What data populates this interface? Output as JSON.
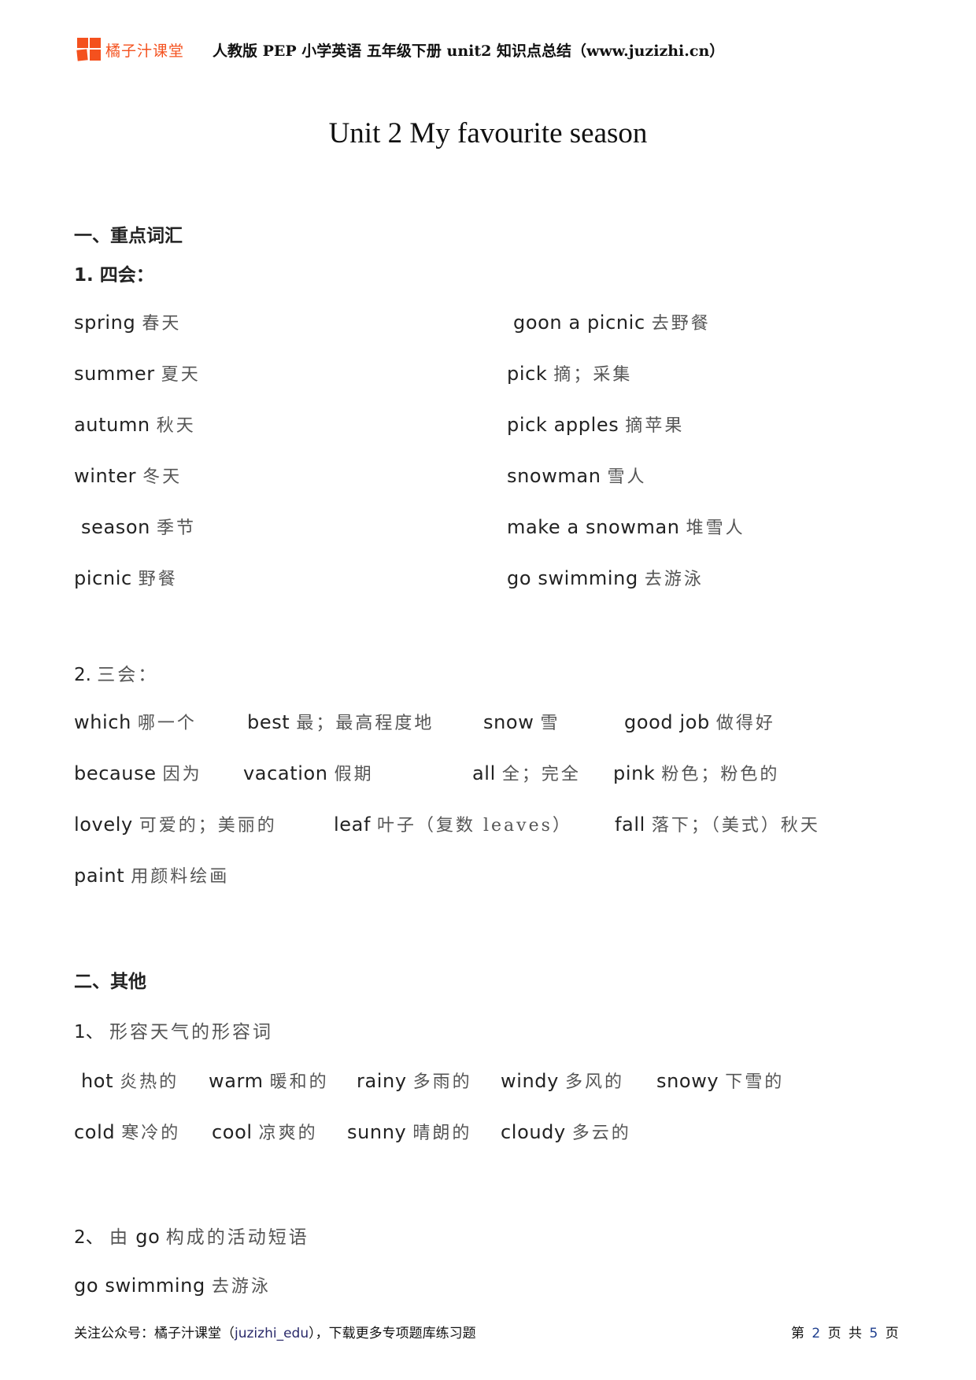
{
  "header": {
    "brand": "橘子汁课堂",
    "brand_color": "#f4511e",
    "text": "人教版 PEP 小学英语 五年级下册   unit2 知识点总结（www.juzizhi.cn）"
  },
  "title": "Unit 2 My favourite season",
  "section1": {
    "heading": "一、重点词汇",
    "four_skills": {
      "label": "1. 四会：",
      "left": [
        {
          "en": "spring",
          "zh": "春天"
        },
        {
          "en": "summer",
          "zh": "夏天"
        },
        {
          "en": "autumn",
          "zh": "秋天"
        },
        {
          "en": "winter",
          "zh": "冬天"
        },
        {
          "en": "season",
          "zh": "季节"
        },
        {
          "en": "picnic",
          "zh": "野餐"
        }
      ],
      "right": [
        {
          "en": "goon a picnic",
          "zh": "去野餐"
        },
        {
          "en": "pick",
          "zh": "摘；采集"
        },
        {
          "en": "pick apples",
          "zh": "摘苹果"
        },
        {
          "en": "snowman",
          "zh": "雪人"
        },
        {
          "en": "make a snowman",
          "zh": "堆雪人"
        },
        {
          "en": "go swimming",
          "zh": "去游泳"
        }
      ]
    },
    "three_skills": {
      "label_num": "2.",
      "label_zh": "三会：",
      "rows": [
        [
          {
            "en": "which",
            "zh": "哪一个"
          },
          {
            "en": "best",
            "zh": "最；最高程度地"
          },
          {
            "en": "snow",
            "zh": "雪"
          },
          {
            "en": "good job",
            "zh": "做得好"
          }
        ],
        [
          {
            "en": "because",
            "zh": "因为"
          },
          {
            "en": "vacation",
            "zh": "假期"
          },
          {
            "en": "all",
            "zh": "全；完全"
          },
          {
            "en": "pink",
            "zh": "粉色；粉色的"
          }
        ],
        [
          {
            "en": "lovely",
            "zh": "可爱的；美丽的"
          },
          {
            "en": "leaf",
            "zh": "叶子（复数 leaves）"
          },
          {
            "en": "fall",
            "zh": "落下；（美式）秋天"
          }
        ],
        [
          {
            "en": "paint",
            "zh": "用颜料绘画"
          }
        ]
      ]
    }
  },
  "section2": {
    "heading": "二、其他",
    "weather": {
      "label_num": "1、",
      "label_zh": "形容天气的形容词",
      "rows": [
        [
          {
            "en": "hot",
            "zh": "炎热的"
          },
          {
            "en": "warm",
            "zh": "暖和的"
          },
          {
            "en": "rainy",
            "zh": "多雨的"
          },
          {
            "en": "windy",
            "zh": "多风的"
          },
          {
            "en": "snowy",
            "zh": "下雪的"
          }
        ],
        [
          {
            "en": "cold",
            "zh": "寒冷的"
          },
          {
            "en": "cool",
            "zh": "凉爽的"
          },
          {
            "en": "sunny",
            "zh": "晴朗的"
          },
          {
            "en": "cloudy",
            "zh": "多云的"
          }
        ]
      ]
    },
    "go_phrases": {
      "label_num": "2、",
      "label_pre": "由",
      "label_go": "go",
      "label_post": "构成的活动短语",
      "items": [
        {
          "en": "go swimming",
          "zh": "去游泳"
        }
      ]
    }
  },
  "footer": {
    "left_pre": "关注公众号：橘子汁课堂（",
    "left_account": "juzizhi_edu",
    "left_post": "），下载更多专项题库练习题",
    "page_pre": "第",
    "page_current": "2",
    "page_mid": "页 共",
    "page_total": "5",
    "page_post": "页"
  }
}
